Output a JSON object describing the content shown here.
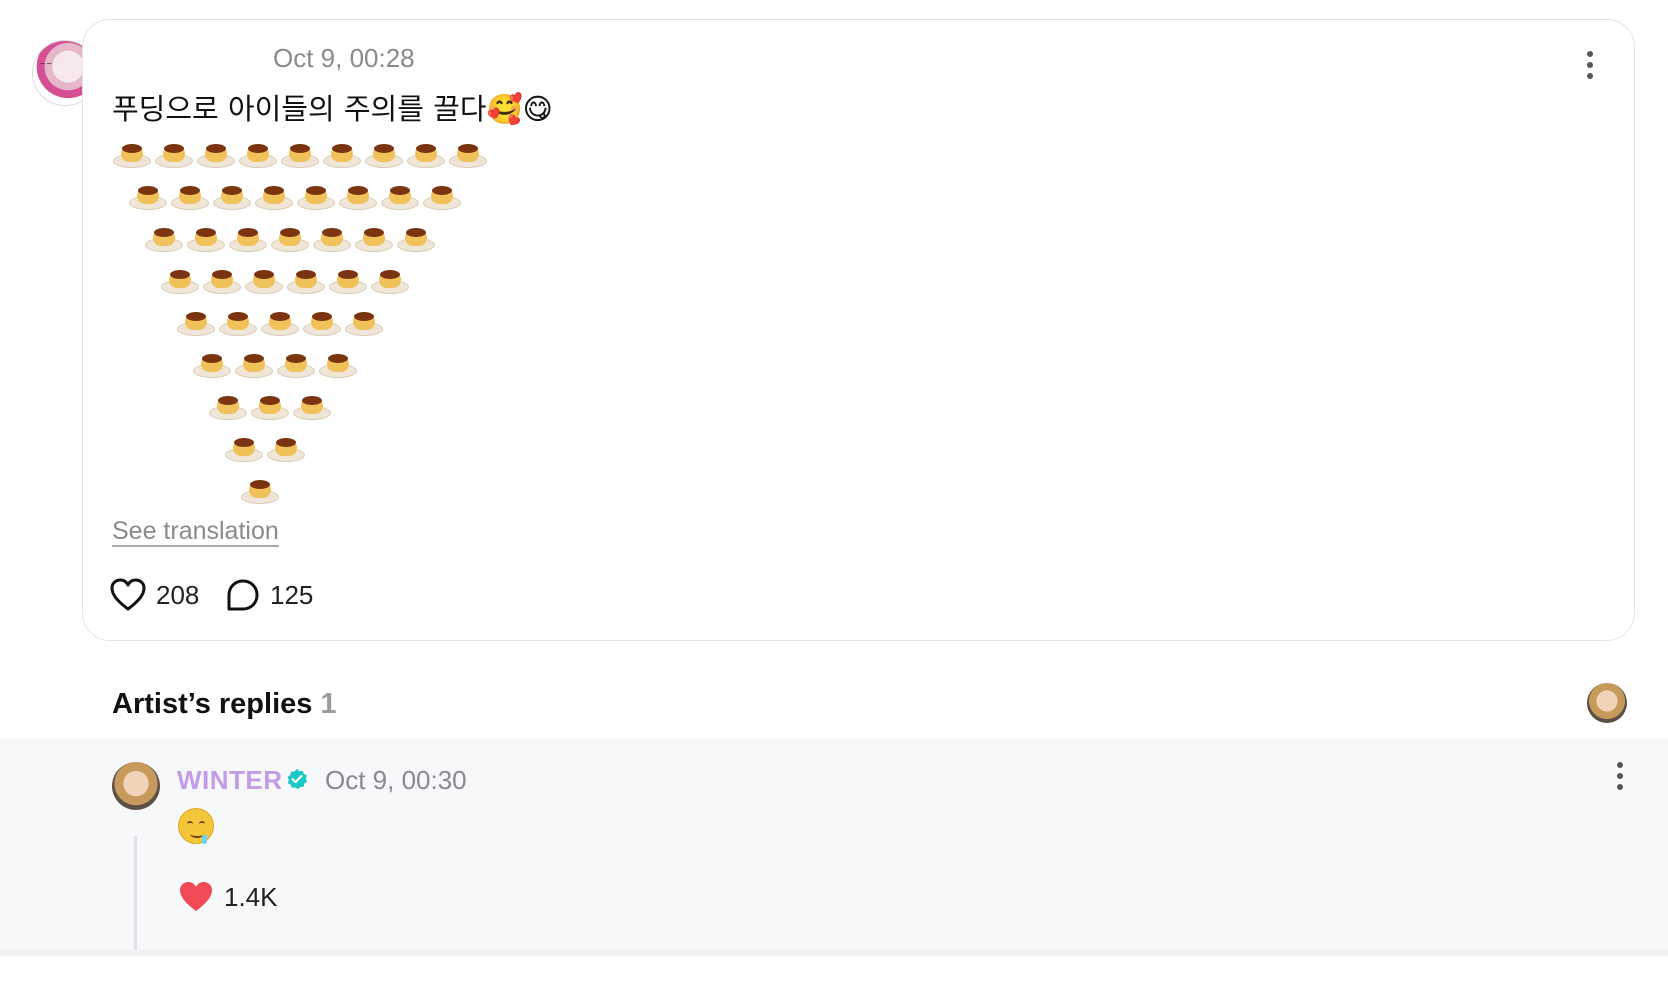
{
  "post": {
    "time": "Oct 9, 00:28",
    "text": "푸딩으로 아이들의 주의를 끌다🥰😋",
    "see_translation": "See translation",
    "like_count": "208",
    "comment_count": "125",
    "pudding_rows": [
      9,
      8,
      7,
      6,
      5,
      4,
      3,
      2,
      1
    ]
  },
  "replies_section": {
    "title": "Artist’s replies",
    "count": "1"
  },
  "reply": {
    "author": "WINTER",
    "time": "Oct 9, 00:30",
    "emoji_icon": "drooling-face-icon",
    "like_count": "1.4K"
  },
  "colors": {
    "accent_name": "#c39be6",
    "verified": "#1bc7c7",
    "heart_filled": "#f24a57"
  }
}
